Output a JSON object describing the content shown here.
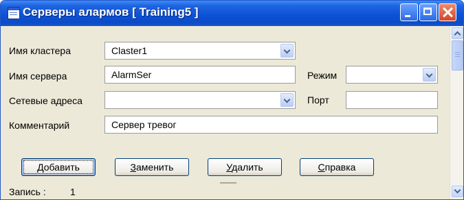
{
  "window": {
    "title": "Серверы алармов [ Training5 ]"
  },
  "labels": {
    "cluster": "Имя кластера",
    "server": "Имя сервера",
    "addresses": "Сетевые адреса",
    "comment": "Комментарий",
    "mode": "Режим",
    "port": "Порт"
  },
  "fields": {
    "cluster": "Claster1",
    "server": "AlarmSer",
    "addresses": "",
    "comment": "Сервер тревог",
    "mode": "",
    "port": ""
  },
  "buttons": {
    "add_hot": "Д",
    "add_rest": "обавить",
    "replace_hot": "З",
    "replace_rest": "аменить",
    "delete_hot": "У",
    "delete_rest": "далить",
    "help_hot": "С",
    "help_rest": "правка"
  },
  "status": {
    "record_label": "Запись :",
    "record_value": "1"
  },
  "icons": [
    "app-window-icon",
    "minimize-icon",
    "maximize-icon",
    "close-icon",
    "dropdown-arrow-icon",
    "scroll-up-icon",
    "scroll-down-icon"
  ],
  "colors": {
    "titlebar": "#0d53d8",
    "window_bg": "#ece9d8",
    "close_button": "#d6452a"
  }
}
